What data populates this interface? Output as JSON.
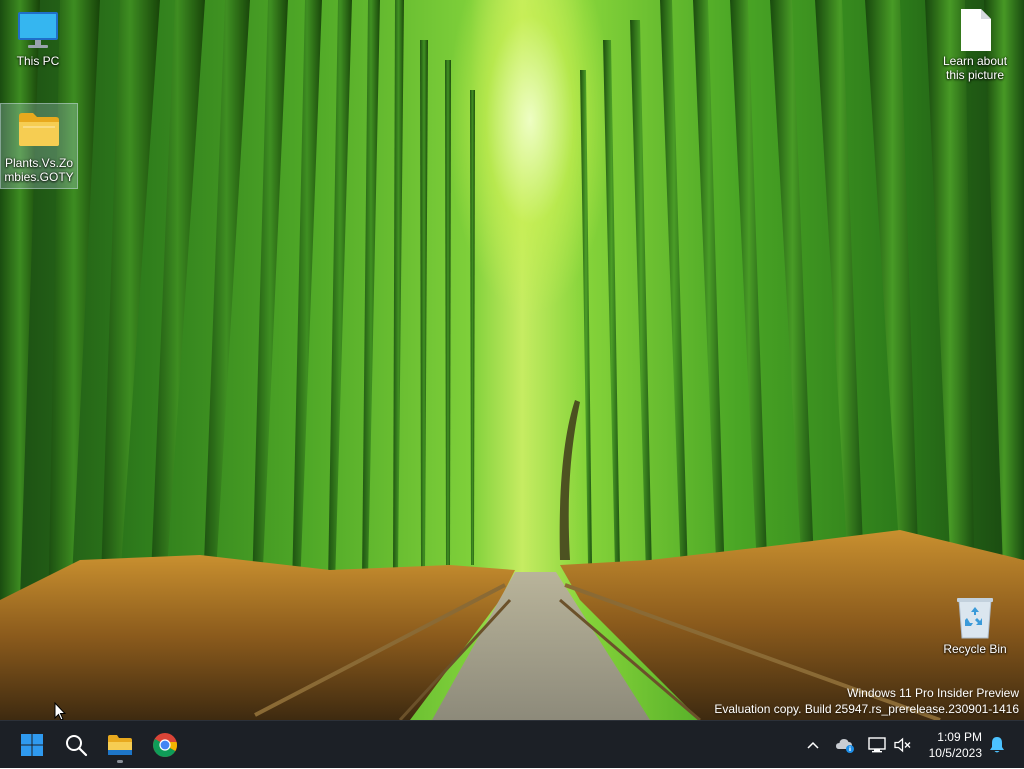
{
  "desktop": {
    "icons": [
      {
        "label": "This PC",
        "icon": "monitor-icon"
      },
      {
        "label": "Plants.Vs.Zombies.GOTY",
        "label_line1": "Plants.Vs.Zo",
        "label_line2": "mbies.GOTY",
        "icon": "folder-icon"
      },
      {
        "label": "Learn about this picture",
        "label_line1": "Learn about",
        "label_line2": "this picture",
        "icon": "document-icon"
      },
      {
        "label": "Recycle Bin",
        "icon": "recycle-bin-icon"
      }
    ]
  },
  "watermark": {
    "line1": "Windows 11 Pro Insider Preview",
    "line2": "Evaluation copy. Build 25947.rs_prerelease.230901-1416"
  },
  "taskbar": {
    "pinned": [
      {
        "name": "Start",
        "icon": "windows-start-icon"
      },
      {
        "name": "Search",
        "icon": "search-icon"
      },
      {
        "name": "File Explorer",
        "icon": "file-explorer-icon"
      },
      {
        "name": "Google Chrome",
        "icon": "chrome-icon"
      }
    ],
    "tray": {
      "icons": [
        "chevron-up-icon",
        "onedrive-icon",
        "network-icon",
        "volume-muted-icon",
        "notification-bell-icon"
      ]
    },
    "clock": {
      "time": "1:09 PM",
      "date": "10/5/2023"
    }
  },
  "colors": {
    "taskbar_bg": "#1c2026",
    "windows_blue": "#2f9af0",
    "folder_yellow": "#f4c542",
    "notification_blue": "#4cc2ff"
  }
}
